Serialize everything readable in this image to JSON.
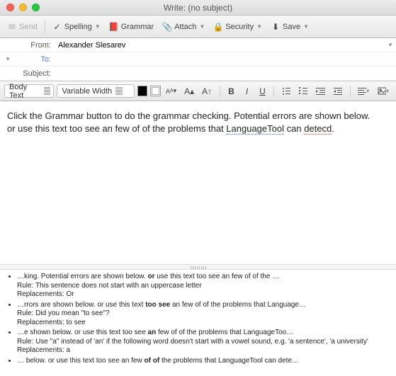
{
  "window": {
    "title": "Write: (no subject)"
  },
  "toolbar": {
    "send": "Send",
    "spelling": "Spelling",
    "grammar": "Grammar",
    "attach": "Attach",
    "security": "Security",
    "save": "Save"
  },
  "headers": {
    "from_label": "From:",
    "from_value": "Alexander Slesarev",
    "to_label": "To:",
    "to_value": "",
    "subject_label": "Subject:",
    "subject_value": ""
  },
  "format": {
    "paragraph_style": "Body Text",
    "font": "Variable Width",
    "size_small": "AA",
    "size_large": "A",
    "smallcaps": "A",
    "superscript": "A↑",
    "bold": "B",
    "italic": "I",
    "underline": "U",
    "ul": "list-ul",
    "ol": "list-ol",
    "outdent": "outdent",
    "indent": "indent",
    "align": "align",
    "more": "more"
  },
  "body": {
    "line1a": "Click the Grammar button to do the grammar checking. Potential errors are shown below.",
    "line2_pre": "or use this text too see an few of of the problems that ",
    "line2_link": "LanguageTool",
    "line2_mid": " can ",
    "line2_err": "detecd",
    "line2_post": "."
  },
  "results": [
    {
      "main_pre": "…king. Potential errors are shown below. ",
      "main_b": "or",
      "main_post": " use this text too see an few of of the …",
      "rule": "Rule: This sentence does not start with an uppercase letter",
      "repl": "Replacements: Or"
    },
    {
      "main_pre": "…rrors are shown below. or use this text ",
      "main_b": "too see",
      "main_post": " an few of of the problems that Language…",
      "rule": "Rule: Did you mean \"to see\"?",
      "repl": "Replacements: to see"
    },
    {
      "main_pre": "…e shown below. or use this text too see ",
      "main_b": "an",
      "main_post": " few of of the problems that LanguageToo…",
      "rule": "Rule: Use \"a\" instead of 'an' if the following word doesn't start with a vowel sound, e.g. 'a sentence', 'a university'",
      "repl": "Replacements: a"
    },
    {
      "main_pre": "… below. or use this text too see an few ",
      "main_b": "of of",
      "main_post": " the problems that LanguageTool can dete…",
      "rule": "",
      "repl": ""
    }
  ]
}
